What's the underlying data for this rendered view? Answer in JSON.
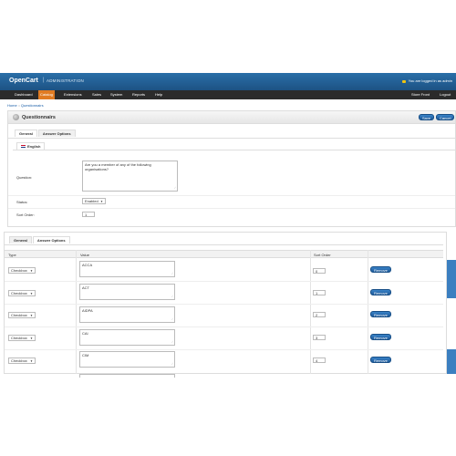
{
  "header": {
    "logo": "OpenCart",
    "separator": "|",
    "subtitle": "ADMINISTRATION",
    "logged_in": "You are logged in as admin"
  },
  "menu": {
    "items": [
      "Dashboard",
      "Catalog",
      "Extensions",
      "Sales",
      "System",
      "Reports",
      "Help"
    ],
    "active": "Catalog",
    "right_items": [
      "Store Front",
      "Logout"
    ]
  },
  "breadcrumb": [
    "Home",
    "Questionnairs"
  ],
  "page": {
    "title": "Questionnairs",
    "save_label": "Save",
    "cancel_label": "Cancel",
    "tabs": [
      "General",
      "Answer Options"
    ],
    "language_tab": "English",
    "question_label": "Question:",
    "question_value": "Are you a member of any of the following organisations?",
    "status_label": "Status:",
    "status_value": "Enabled",
    "sort_order_label": "Sort Order:",
    "sort_order_value": "1"
  },
  "answers": {
    "tabs": [
      "General",
      "Answer Options"
    ],
    "columns": [
      "Type",
      "Value",
      "Sort Order"
    ],
    "remove_label": "Remove",
    "rows": [
      {
        "type": "Checkbox",
        "value": "ACCA",
        "sort": "0"
      },
      {
        "type": "Checkbox",
        "value": "ACT",
        "sort": "1"
      },
      {
        "type": "Checkbox",
        "value": "AIDPA",
        "sort": "2"
      },
      {
        "type": "Checkbox",
        "value": "CAI",
        "sort": "3"
      },
      {
        "type": "Checkbox",
        "value": "CIM",
        "sort": "4"
      }
    ]
  },
  "colors": {
    "header": "#1d5283",
    "menu": "#2b2b2b",
    "menu_active": "#e07b22",
    "button": "#1d5a9a"
  }
}
